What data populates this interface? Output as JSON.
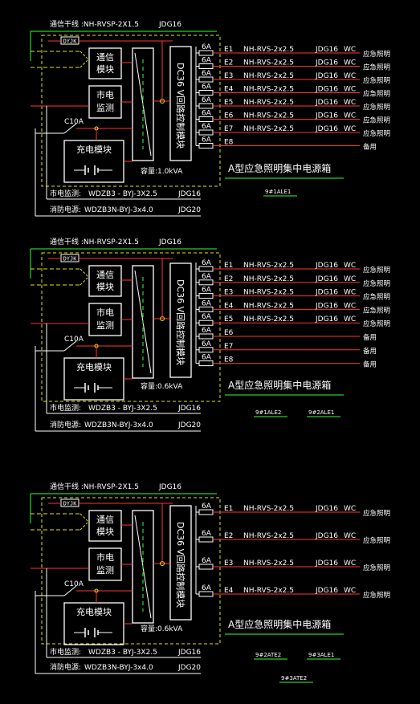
{
  "colors": {
    "background": "#000000",
    "white": "#ffffff",
    "green": "#33ff33",
    "yellow": "#e6e600",
    "red": "#ff3333",
    "cyan": "#00ffff",
    "gray": "#c0c0c0"
  },
  "panels": [
    {
      "comm_line": "通信干线 :NH-RVSP-2X1.5",
      "comm_jdg": "JDG16",
      "tag": "DYJK",
      "module_comm": [
        "通信",
        "模块"
      ],
      "module_mains": [
        "市电",
        "监测"
      ],
      "module_charger": "充电模块",
      "breaker": "C10A",
      "controller": "DC36 V回路控制模块",
      "capacity": "容量:1.0kVA",
      "box_title": "A型应急照明集中电源箱",
      "mains_line": "市电监测:",
      "mains_cable": "WDZB3 - BYJ-3X2.5",
      "mains_jdg": "JDG16",
      "fire_line": "消防电源:",
      "fire_cable": "WDZB3N-BYJ-3x4.0",
      "fire_jdg": "JDG20",
      "refs": [
        "9#1ALE1"
      ],
      "circuits": [
        {
          "name": "E1",
          "rating": "6A",
          "cable": "NH-RVS-2x2.5",
          "conduit": "JDG16",
          "method": "WC",
          "use": "应急照明"
        },
        {
          "name": "E2",
          "rating": "6A",
          "cable": "NH-RVS-2x2.5",
          "conduit": "JDG16",
          "method": "WC",
          "use": "应急照明"
        },
        {
          "name": "E3",
          "rating": "6A",
          "cable": "NH-RVS-2x2.5",
          "conduit": "JDG16",
          "method": "WC",
          "use": "应急照明"
        },
        {
          "name": "E4",
          "rating": "6A",
          "cable": "NH-RVS-2x2.5",
          "conduit": "JDG16",
          "method": "WC",
          "use": "应急照明"
        },
        {
          "name": "E5",
          "rating": "6A",
          "cable": "NH-RVS-2x2.5",
          "conduit": "JDG16",
          "method": "WC",
          "use": "应急照明"
        },
        {
          "name": "E6",
          "rating": "6A",
          "cable": "NH-RVS-2x2.5",
          "conduit": "JDG16",
          "method": "WC",
          "use": "应急照明"
        },
        {
          "name": "E7",
          "rating": "6A",
          "cable": "NH-RVS-2x2.5",
          "conduit": "JDG16",
          "method": "WC",
          "use": "应急照明"
        },
        {
          "name": "E8",
          "rating": "6A",
          "cable": "",
          "conduit": "",
          "method": "",
          "use": "备用"
        }
      ]
    },
    {
      "comm_line": "通信干线 :NH-RVSP-2X1.5",
      "comm_jdg": "JDG16",
      "tag": "DYJK",
      "module_comm": [
        "通信",
        "模块"
      ],
      "module_mains": [
        "市电",
        "监测"
      ],
      "module_charger": "充电模块",
      "breaker": "C10A",
      "controller": "DC36 V回路控制模块",
      "capacity": "容量:0.6kVA",
      "box_title": "A型应急照明集中电源箱",
      "mains_line": "市电监测:",
      "mains_cable": "WDZB3 - BYJ-3X2.5",
      "mains_jdg": "JDG16",
      "fire_line": "消防电源:",
      "fire_cable": "WDZB3N-BYJ-3x4.0",
      "fire_jdg": "JDG20",
      "refs": [
        "9#1ALE2",
        "9#2ALE1"
      ],
      "circuits": [
        {
          "name": "E1",
          "rating": "6A",
          "cable": "NH-RVS-2x2.5",
          "conduit": "JDG16",
          "method": "WC",
          "use": "应急照明"
        },
        {
          "name": "E2",
          "rating": "6A",
          "cable": "NH-RVS-2x2.5",
          "conduit": "JDG16",
          "method": "WC",
          "use": "应急照明"
        },
        {
          "name": "E3",
          "rating": "6A",
          "cable": "NH-RVS-2x2.5",
          "conduit": "JDG16",
          "method": "WC",
          "use": "应急照明"
        },
        {
          "name": "E4",
          "rating": "6A",
          "cable": "NH-RVS-2x2.5",
          "conduit": "JDG16",
          "method": "WC",
          "use": "应急照明"
        },
        {
          "name": "E5",
          "rating": "6A",
          "cable": "NH-RVS-2x2.5",
          "conduit": "JDG16",
          "method": "WC",
          "use": "应急照明"
        },
        {
          "name": "E6",
          "rating": "6A",
          "cable": "",
          "conduit": "",
          "method": "",
          "use": "备用"
        },
        {
          "name": "E7",
          "rating": "6A",
          "cable": "",
          "conduit": "",
          "method": "",
          "use": "备用"
        },
        {
          "name": "E8",
          "rating": "6A",
          "cable": "",
          "conduit": "",
          "method": "",
          "use": "备用"
        }
      ]
    },
    {
      "comm_line": "通信干线 :NH-RVSP-2X1.5",
      "comm_jdg": "JDG16",
      "tag": "DYJK",
      "module_comm": [
        "通信",
        "模块"
      ],
      "module_mains": [
        "市电",
        "监测"
      ],
      "module_charger": "充电模块",
      "breaker": "C10A",
      "controller": "DC36 V回路控制模块",
      "capacity": "容量:0.6kVA",
      "box_title": "A型应急照明集中电源箱",
      "mains_line": "市电监测:",
      "mains_cable": "WDZB3 - BYJ-3X2.5",
      "mains_jdg": "JDG16",
      "fire_line": "消防电源:",
      "fire_cable": "WDZB3N-BYJ-3x4.0",
      "fire_jdg": "JDG20",
      "refs": [
        "9#2ATE2",
        "9#3ALE1",
        "9#3ATE2"
      ],
      "circuits": [
        {
          "name": "E1",
          "rating": "6A",
          "cable": "NH-RVS-2x2.5",
          "conduit": "JDG16",
          "method": "WC",
          "use": "应急照明"
        },
        {
          "name": "E2",
          "rating": "6A",
          "cable": "NH-RVS-2x2.5",
          "conduit": "JDG16",
          "method": "WC",
          "use": "应急照明"
        },
        {
          "name": "E3",
          "rating": "6A",
          "cable": "NH-RVS-2x2.5",
          "conduit": "JDG16",
          "method": "WC",
          "use": "应急照明"
        },
        {
          "name": "E4",
          "rating": "6A",
          "cable": "NH-RVS-2x2.5",
          "conduit": "JDG16",
          "method": "WC",
          "use": "应急照明"
        }
      ]
    }
  ]
}
